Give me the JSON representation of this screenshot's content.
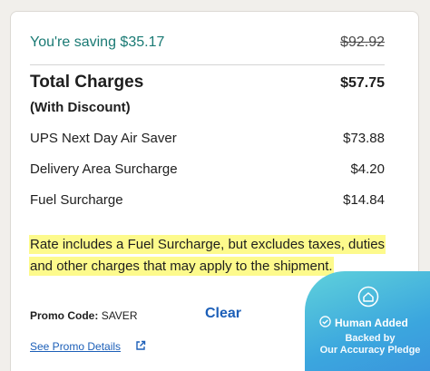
{
  "savings": {
    "label": "You're saving $35.17",
    "original_price": "$92.92"
  },
  "total": {
    "label": "Total Charges",
    "sublabel": "(With Discount)",
    "value": "$57.75"
  },
  "line_items": [
    {
      "label": "UPS Next Day Air Saver",
      "value": "$73.88"
    },
    {
      "label": "Delivery Area Surcharge",
      "value": "$4.20"
    },
    {
      "label": "Fuel Surcharge",
      "value": "$14.84"
    }
  ],
  "note": "Rate includes a Fuel Surcharge, but excludes taxes, duties and other charges that may apply to the shipment.",
  "promo": {
    "label": "Promo Code:",
    "code": "SAVER",
    "clear_label": "Clear",
    "details_link": "See Promo Details"
  },
  "badge": {
    "title": "Human Added",
    "subtitle_line1": "Backed by",
    "subtitle_line2": "Our Accuracy Pledge",
    "icons": [
      "home-shield-icon",
      "check-circle-icon"
    ]
  },
  "colors": {
    "saving_green": "#1a7a74",
    "link_blue": "#1c5fb8",
    "highlight_yellow": "#fdfa8c",
    "badge_gradient_start": "#5fd1db",
    "badge_gradient_end": "#3a8fdc"
  }
}
